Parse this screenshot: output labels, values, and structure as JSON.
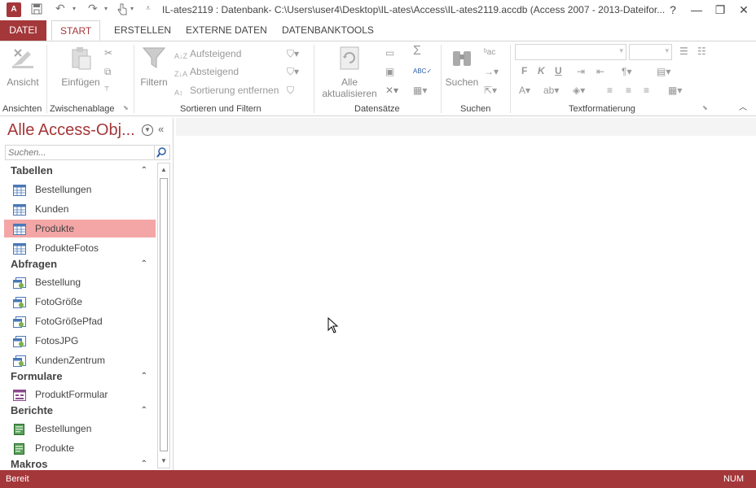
{
  "title": "IL-ates2119 : Datenbank- C:\\Users\\user4\\Desktop\\IL-ates\\Access\\IL-ates2119.accdb (Access 2007 - 2013-Dateifor...",
  "app_logo": "A",
  "window": {
    "help": "?",
    "minimize": "—",
    "restore": "❐",
    "close": "✕"
  },
  "tabs": {
    "file": "DATEI",
    "start": "START",
    "create": "ERSTELLEN",
    "external": "EXTERNE DATEN",
    "tools": "DATENBANKTOOLS"
  },
  "ribbon": {
    "views": {
      "btn": "Ansicht",
      "label": "Ansichten"
    },
    "clipboard": {
      "btn": "Einfügen",
      "label": "Zwischenablage"
    },
    "sort": {
      "filter": "Filtern",
      "asc": "Aufsteigend",
      "desc": "Absteigend",
      "remove": "Sortierung entfernen",
      "label": "Sortieren und Filtern"
    },
    "records": {
      "refresh_1": "Alle",
      "refresh_2": "aktualisieren",
      "label": "Datensätze"
    },
    "find": {
      "btn": "Suchen",
      "label": "Suchen"
    },
    "format": {
      "bold": "F",
      "italic": "K",
      "underline": "U",
      "label": "Textformatierung"
    }
  },
  "nav": {
    "title": "Alle Access-Obj...",
    "search_placeholder": "Suchen...",
    "categories": [
      {
        "label": "Tabellen",
        "items": [
          "Bestellungen",
          "Kunden",
          "Produkte",
          "ProdukteFotos"
        ]
      },
      {
        "label": "Abfragen",
        "items": [
          "Bestellung",
          "FotoGröße",
          "FotoGrößePfad",
          "FotosJPG",
          "KundenZentrum"
        ]
      },
      {
        "label": "Formulare",
        "items": [
          "ProduktFormular"
        ]
      },
      {
        "label": "Berichte",
        "items": [
          "Bestellungen",
          "Produkte"
        ]
      },
      {
        "label": "Makros",
        "items": []
      }
    ],
    "selected": "Produkte"
  },
  "status": {
    "left": "Bereit",
    "right": "NUM"
  },
  "colors": {
    "accent": "#a4373a",
    "selected": "#f4a6a6"
  }
}
